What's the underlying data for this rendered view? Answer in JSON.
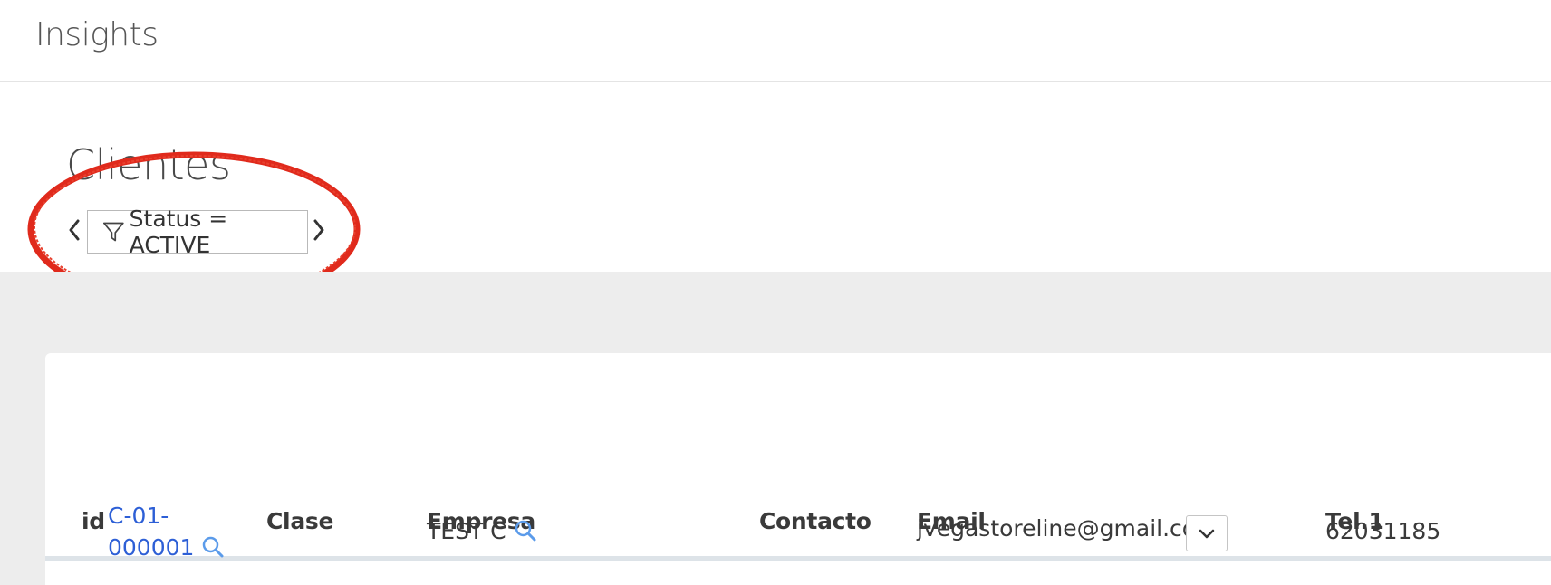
{
  "app": {
    "title": "Insights"
  },
  "page": {
    "title": "Clientes"
  },
  "filter": {
    "label": "Status = ACTIVE"
  },
  "table": {
    "columns": [
      "id",
      "Clase",
      "Empresa",
      "Contacto",
      "Email",
      "Tel.1"
    ],
    "rows": [
      {
        "id_line1": "C-01-",
        "id_line2": "000001",
        "clase": "",
        "empresa": "TEST C",
        "contacto": "",
        "email": "jvegastoreline@gmail.com",
        "tel1": "62031185"
      }
    ]
  },
  "icons": {
    "filter": "funnel-icon",
    "prev": "chevron-left-icon",
    "next": "chevron-right-icon",
    "search": "search-icon",
    "dropdown": "chevron-down-icon"
  },
  "colors": {
    "link": "#2d5fd6",
    "search_icon": "#5b9bea",
    "annotation": "#e02a1c",
    "content_background": "#ededed"
  }
}
